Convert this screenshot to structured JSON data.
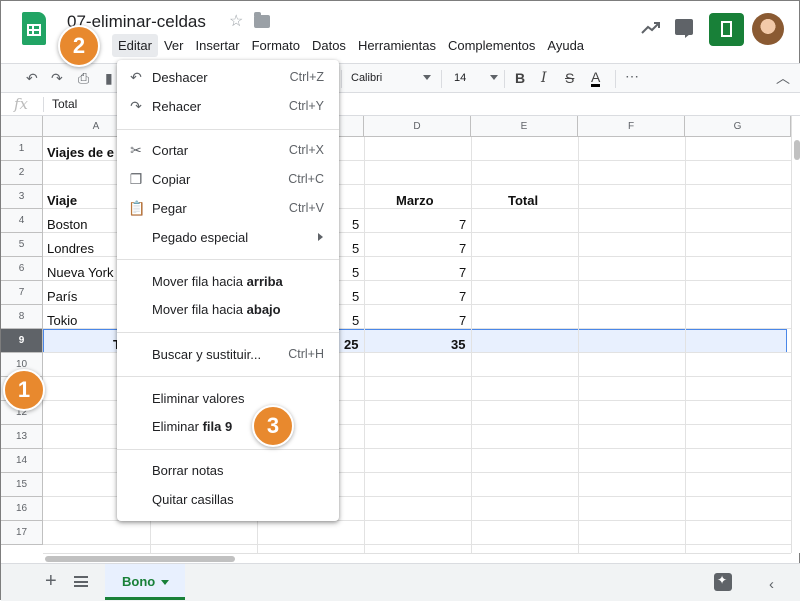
{
  "app": {
    "title": "07-eliminar-celdas"
  },
  "menubar": [
    "Editar",
    "Ver",
    "Insertar",
    "Formato",
    "Datos",
    "Herramientas",
    "Complementos",
    "Ayuda"
  ],
  "toolbar": {
    "font": "Calibri",
    "font_size": "14",
    "more": "⋯"
  },
  "formula_bar": {
    "value": "Total"
  },
  "columns": [
    "A",
    "D",
    "E",
    "F",
    "G"
  ],
  "rows": [
    "1",
    "2",
    "3",
    "4",
    "5",
    "6",
    "7",
    "8",
    "9",
    "10",
    "11",
    "12",
    "13",
    "14",
    "15",
    "16",
    "17"
  ],
  "cells": {
    "a1": "Viajes de e",
    "a3": "Viaje",
    "d3": "Marzo",
    "e3": "Total",
    "a4": "Boston",
    "c4": "5",
    "d4": "7",
    "a5": "Londres",
    "c5": "5",
    "d5": "7",
    "a6": "Nueva York",
    "c6": "5",
    "d6": "7",
    "a7": "París",
    "c7": "5",
    "d7": "7",
    "a8": "Tokio",
    "c8": "5",
    "d8": "7",
    "a9": "T",
    "c9": "25",
    "d9": "35"
  },
  "menu": {
    "undo": {
      "label": "Deshacer",
      "shortcut": "Ctrl+Z"
    },
    "redo": {
      "label": "Rehacer",
      "shortcut": "Ctrl+Y"
    },
    "cut": {
      "label": "Cortar",
      "shortcut": "Ctrl+X"
    },
    "copy": {
      "label": "Copiar",
      "shortcut": "Ctrl+C"
    },
    "paste": {
      "label": "Pegar",
      "shortcut": "Ctrl+V"
    },
    "paste_special": {
      "label": "Pegado especial"
    },
    "move_up": {
      "label": "Mover fila hacia ",
      "bold": "arriba"
    },
    "move_down": {
      "label": "Mover fila hacia ",
      "bold": "abajo"
    },
    "find": {
      "label": "Buscar y sustituir...",
      "shortcut": "Ctrl+H"
    },
    "clear_values": {
      "label": "Eliminar valores"
    },
    "delete_row": {
      "label": "Eliminar ",
      "bold": "fila 9"
    },
    "clear_notes": {
      "label": "Borrar notas"
    },
    "remove_checkboxes": {
      "label": "Quitar casillas"
    }
  },
  "sheet_tab": {
    "label": "Bono"
  },
  "callouts": [
    "1",
    "2",
    "3"
  ],
  "colors": {
    "accent": "#188038",
    "callout": "#e8892e",
    "selection": "#4a87e8"
  }
}
